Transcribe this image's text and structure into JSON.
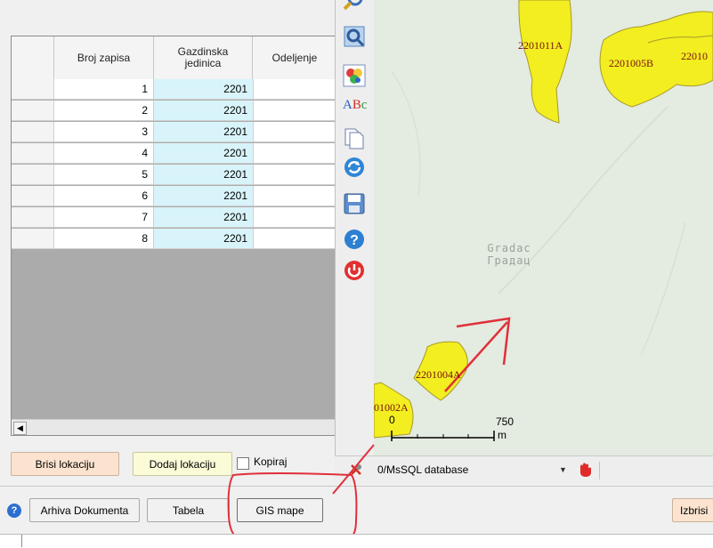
{
  "grid": {
    "headers": [
      "Broj zapisa",
      "Gazdinska jedinica",
      "Odeljenje"
    ],
    "rows": [
      {
        "num": "1",
        "gj": "2201"
      },
      {
        "num": "2",
        "gj": "2201"
      },
      {
        "num": "3",
        "gj": "2201"
      },
      {
        "num": "4",
        "gj": "2201"
      },
      {
        "num": "5",
        "gj": "2201"
      },
      {
        "num": "6",
        "gj": "2201"
      },
      {
        "num": "7",
        "gj": "2201"
      },
      {
        "num": "8",
        "gj": "2201"
      }
    ]
  },
  "location_buttons": {
    "delete": "Brisi lokaciju",
    "add": "Dodaj lokaciju",
    "copy": "Kopiraj"
  },
  "bottom_bar": {
    "archive": "Arhiva Dokumenta",
    "table": "Tabela",
    "gis": "GIS mape",
    "delete": "Izbrisi"
  },
  "map": {
    "place_latin": "Gradac",
    "place_cyrillic": "Градац",
    "parcels": [
      "2201011A",
      "2201005B",
      "22010",
      "2201004A",
      "01002A"
    ],
    "scale": {
      "zero": "0",
      "max": "750",
      "unit": "m"
    }
  },
  "status": {
    "database": "0/MsSQL database"
  },
  "colors": {
    "parcel_fill": "#f2ee20",
    "map_bg": "#e4ebe0",
    "annotation": "#e0303a",
    "row_highlight": "#d8f4fa"
  },
  "icons": [
    "zoom-icon",
    "zoom-extent-icon",
    "color-palette-icon",
    "label-text-icon",
    "copy-map-icon",
    "refresh-icon",
    "save-icon",
    "help-icon",
    "power-icon",
    "info-icon",
    "tool-icon",
    "hand-icon"
  ]
}
